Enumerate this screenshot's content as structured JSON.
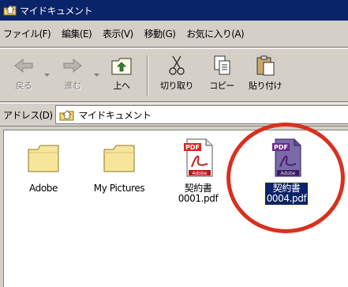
{
  "window": {
    "title": "マイドキュメント"
  },
  "menubar": {
    "items": [
      {
        "label": "ファイル(F)"
      },
      {
        "label": "編集(E)"
      },
      {
        "label": "表示(V)"
      },
      {
        "label": "移動(G)"
      },
      {
        "label": "お気に入り(A)"
      }
    ]
  },
  "toolbar": {
    "buttons": [
      {
        "label": "戻る",
        "icon": "back-arrow-icon",
        "enabled": false
      },
      {
        "label": "進む",
        "icon": "forward-arrow-icon",
        "enabled": false
      },
      {
        "label": "上へ",
        "icon": "up-folder-icon",
        "enabled": true
      },
      {
        "label": "切り取り",
        "icon": "scissors-icon",
        "enabled": true
      },
      {
        "label": "コピー",
        "icon": "copy-icon",
        "enabled": true
      },
      {
        "label": "貼り付け",
        "icon": "paste-icon",
        "enabled": true
      }
    ]
  },
  "addressbar": {
    "label": "アドレス(D)",
    "value": "マイドキュメント",
    "icon": "my-documents-folder-icon"
  },
  "files": [
    {
      "name": "Adobe",
      "type": "folder",
      "icon": "folder-icon",
      "selected": false
    },
    {
      "name": "My Pictures",
      "type": "folder",
      "icon": "folder-icon",
      "selected": false
    },
    {
      "name_line1": "契約書",
      "name_line2": "0001.pdf",
      "type": "pdf",
      "icon": "pdf-file-icon",
      "selected": false
    },
    {
      "name_line1": "契約書",
      "name_line2": "0004.pdf",
      "type": "pdf",
      "icon": "pdf-file-icon",
      "selected": true
    }
  ],
  "pdf_badge": "PDF",
  "pdf_brand": "Adobe",
  "colors": {
    "titlebar": "#0a246a",
    "window_face": "#d4d0c8",
    "highlight_circle": "#d9301f",
    "selection": "#0a246a"
  }
}
